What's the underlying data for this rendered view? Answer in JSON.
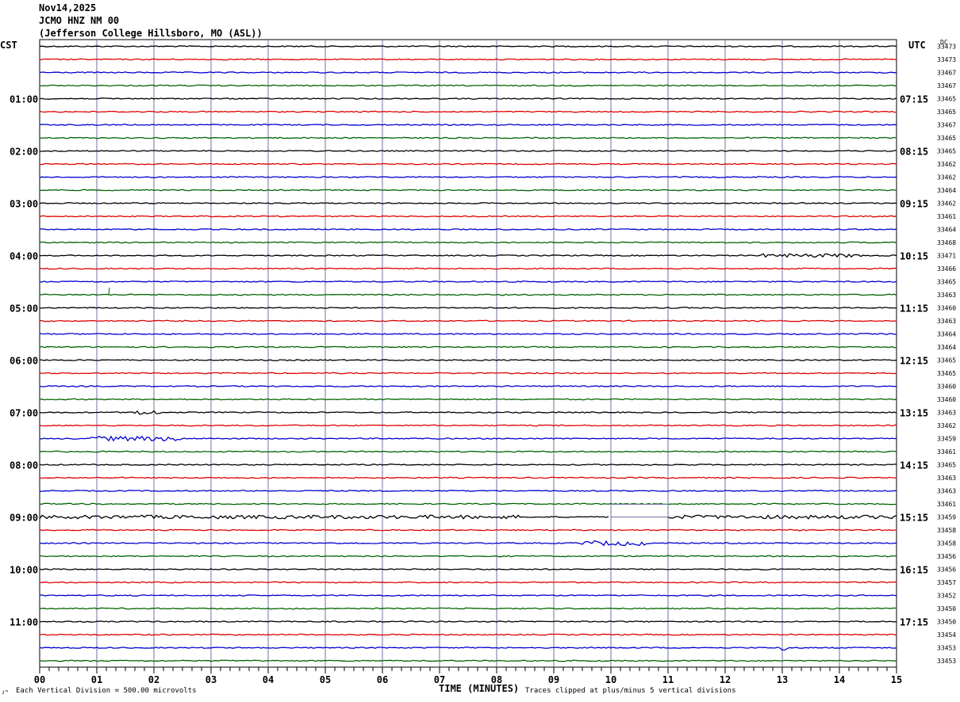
{
  "header": {
    "date": "Nov14,2025",
    "station": "JCMO HNZ NM 00",
    "location": "(Jefferson College Hillsboro, MO (ASL))"
  },
  "left_zone": "CST",
  "right_zone": "UTC",
  "dc_label": "DC",
  "footer": {
    "division_note": "Each Vertical Division =  500.00 microvolts",
    "xlabel": "TIME (MINUTES)",
    "clip_note": "Traces clipped at plus/minus 5 vertical divisions",
    "corner_mark": "ᴊᴹ"
  },
  "chart_data": {
    "type": "line",
    "title": "",
    "xlabel": "TIME (MINUTES)",
    "xlim": [
      0,
      15
    ],
    "x_ticks": [
      "00",
      "01",
      "02",
      "03",
      "04",
      "05",
      "06",
      "07",
      "08",
      "09",
      "10",
      "11",
      "12",
      "13",
      "14",
      "15"
    ],
    "rows": 48,
    "row_minutes": 15,
    "trace_colors": [
      "#000000",
      "#e00000",
      "#0000d0",
      "#006400"
    ],
    "grid_color": "#7070a0",
    "left_hour_labels": [
      {
        "row": 4,
        "label": "01:00"
      },
      {
        "row": 8,
        "label": "02:00"
      },
      {
        "row": 12,
        "label": "03:00"
      },
      {
        "row": 16,
        "label": "04:00"
      },
      {
        "row": 20,
        "label": "05:00"
      },
      {
        "row": 24,
        "label": "06:00"
      },
      {
        "row": 28,
        "label": "07:00"
      },
      {
        "row": 32,
        "label": "08:00"
      },
      {
        "row": 36,
        "label": "09:00"
      },
      {
        "row": 40,
        "label": "10:00"
      },
      {
        "row": 44,
        "label": "11:00"
      }
    ],
    "right_hour_labels": [
      {
        "row": 4,
        "label": "07:15"
      },
      {
        "row": 8,
        "label": "08:15"
      },
      {
        "row": 12,
        "label": "09:15"
      },
      {
        "row": 16,
        "label": "10:15"
      },
      {
        "row": 20,
        "label": "11:15"
      },
      {
        "row": 24,
        "label": "12:15"
      },
      {
        "row": 28,
        "label": "13:15"
      },
      {
        "row": 32,
        "label": "14:15"
      },
      {
        "row": 36,
        "label": "15:15"
      },
      {
        "row": 40,
        "label": "16:15"
      },
      {
        "row": 44,
        "label": "17:15"
      }
    ],
    "dc_offsets": [
      "33473",
      "33473",
      "33467",
      "33467",
      "33465",
      "33465",
      "33467",
      "33465",
      "33465",
      "33462",
      "33462",
      "33464",
      "33462",
      "33461",
      "33464",
      "33468",
      "33471",
      "33466",
      "33465",
      "33463",
      "33460",
      "33463",
      "33464",
      "33464",
      "33465",
      "33465",
      "33460",
      "33460",
      "33463",
      "33462",
      "33459",
      "33461",
      "33465",
      "33463",
      "33463",
      "33461",
      "33459",
      "33458",
      "33458",
      "33456",
      "33456",
      "33457",
      "33452",
      "33450",
      "33450",
      "33454",
      "33453",
      "33453"
    ],
    "data_gaps": [
      {
        "row": 36,
        "start_min": 10.0,
        "end_min": 11.0
      }
    ],
    "events": [
      {
        "row": 16,
        "start_min": 12.6,
        "end_min": 14.4,
        "amp": 2.2
      },
      {
        "row": 28,
        "start_min": 1.6,
        "end_min": 2.1,
        "amp": 3.0
      },
      {
        "row": 30,
        "start_min": 0.9,
        "end_min": 2.5,
        "amp": 3.0
      },
      {
        "row": 36,
        "start_min": 0.0,
        "end_min": 8.4,
        "amp": 2.2
      },
      {
        "row": 36,
        "start_min": 11.0,
        "end_min": 15.0,
        "amp": 2.2
      },
      {
        "row": 38,
        "start_min": 9.5,
        "end_min": 10.6,
        "amp": 3.0
      },
      {
        "row": 46,
        "start_min": 13.0,
        "end_min": 13.1,
        "amp": 9.0
      }
    ]
  }
}
